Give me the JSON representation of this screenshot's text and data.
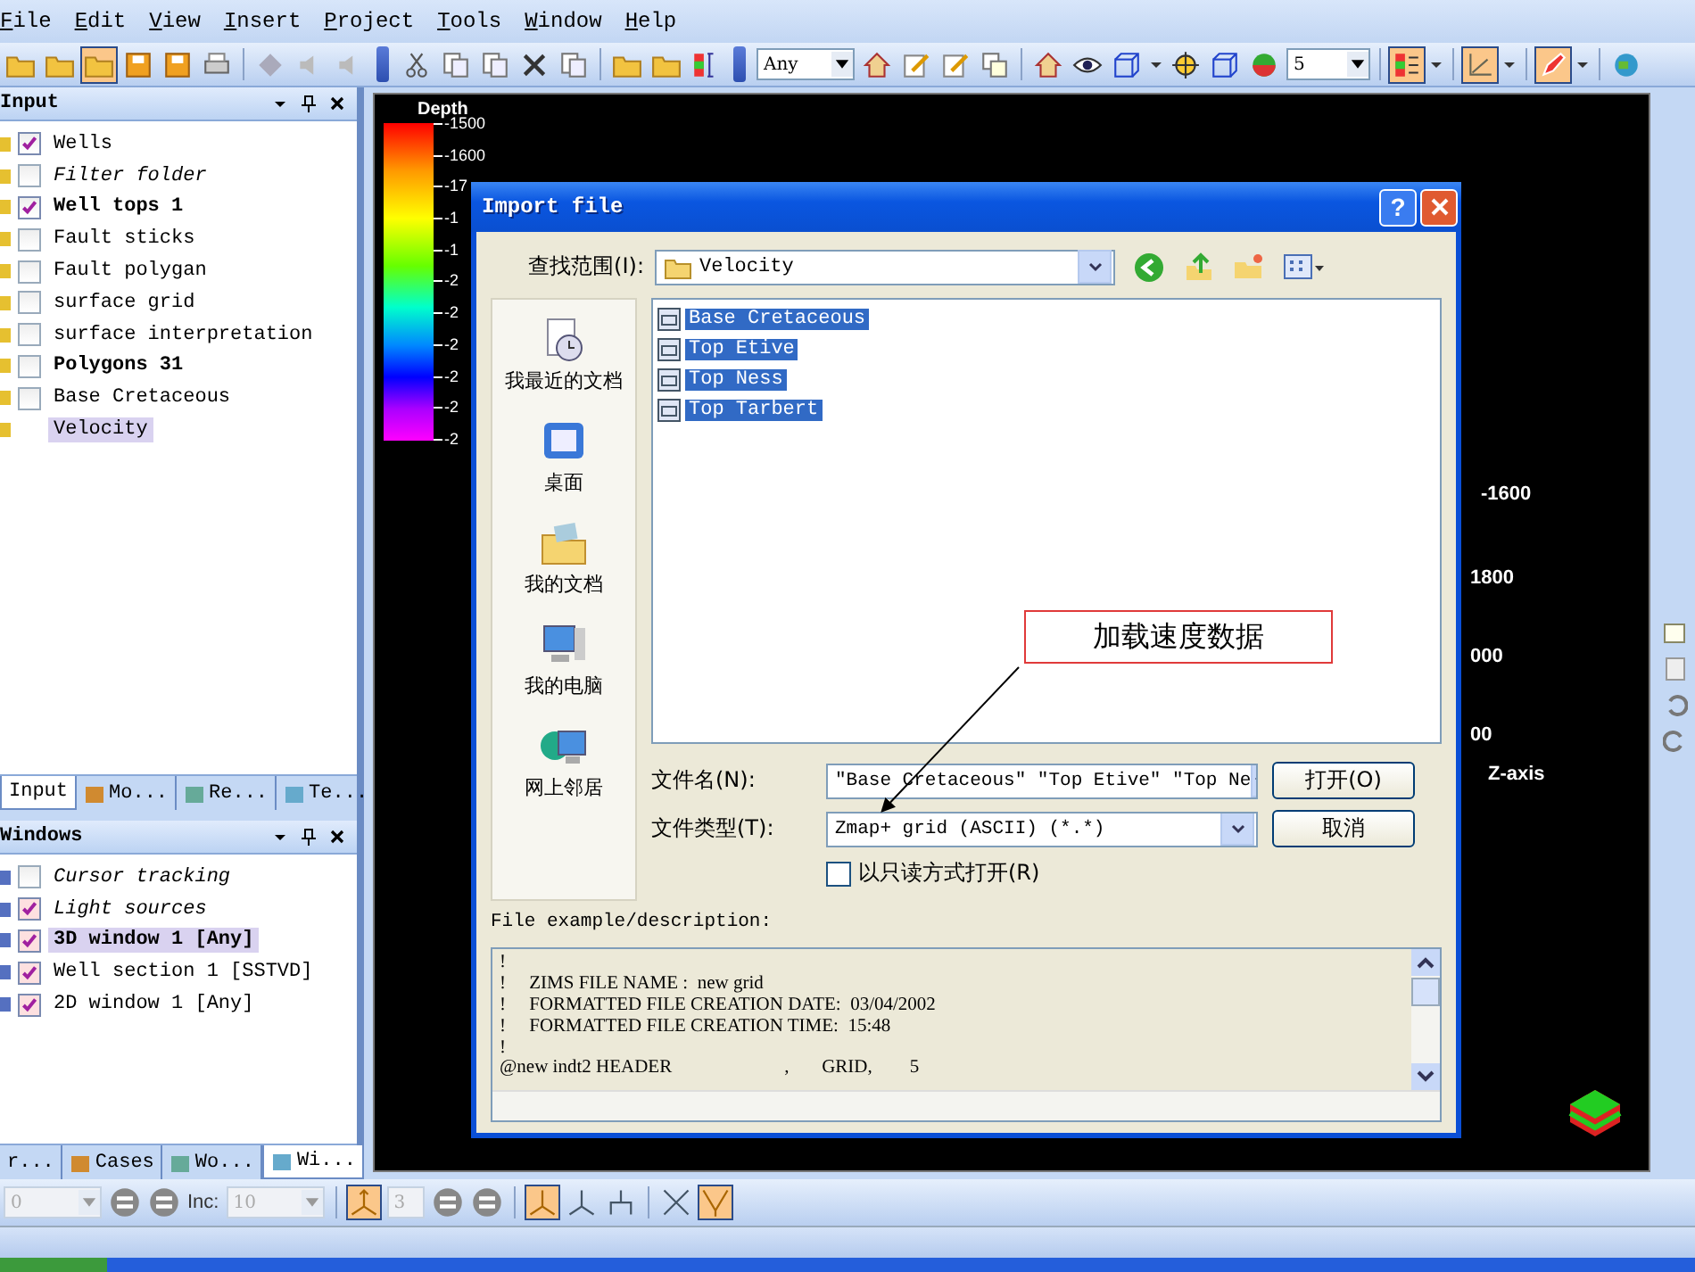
{
  "menu": [
    "File",
    "Edit",
    "View",
    "Insert",
    "Project",
    "Tools",
    "Window",
    "Help"
  ],
  "toolbar": {
    "filter_combo": "Any",
    "size_combo": "5"
  },
  "input_panel": {
    "title": "Input",
    "items": [
      {
        "label": "Wells",
        "kind": "check",
        "checked": true,
        "selected": false
      },
      {
        "label": "Filter folder",
        "kind": "check_italic",
        "checked": false,
        "selected": false
      },
      {
        "label": "Well tops 1",
        "kind": "check_bold",
        "checked": true,
        "selected": false
      },
      {
        "label": "Fault sticks",
        "kind": "check",
        "checked": false,
        "selected": false
      },
      {
        "label": "Fault polygan",
        "kind": "check",
        "checked": false,
        "selected": false
      },
      {
        "label": "surface grid",
        "kind": "check",
        "checked": false,
        "selected": false
      },
      {
        "label": "surface interpretation",
        "kind": "check",
        "checked": false,
        "selected": false
      },
      {
        "label": "Polygons 31",
        "kind": "check_bold",
        "checked": false,
        "selected": false
      },
      {
        "label": "Base Cretaceous",
        "kind": "check",
        "checked": false,
        "selected": false
      },
      {
        "label": "Velocity",
        "kind": "plain",
        "selected": true
      }
    ],
    "tabs": [
      {
        "label": "Input",
        "selected": true
      },
      {
        "label": "Mo...",
        "selected": false
      },
      {
        "label": "Re...",
        "selected": false
      },
      {
        "label": "Te...",
        "selected": false
      }
    ]
  },
  "windows_panel": {
    "title": "Windows",
    "items": [
      {
        "label": "Cursor tracking",
        "kind": "check_italic",
        "checked": false,
        "selected": false
      },
      {
        "label": "Light sources",
        "kind": "check_italic",
        "checked": true,
        "selected": false
      },
      {
        "label": "3D window 1 [Any]",
        "kind": "check_bold",
        "checked": true,
        "selected": true
      },
      {
        "label": "Well section 1 [SSTVD]",
        "kind": "check",
        "checked": true,
        "selected": false
      },
      {
        "label": "2D window 1 [Any]",
        "kind": "check",
        "checked": true,
        "selected": false
      }
    ],
    "tabs": [
      {
        "label": "r...",
        "selected": false
      },
      {
        "label": "Cases",
        "selected": false
      },
      {
        "label": "Wo...",
        "selected": false
      },
      {
        "label": "Wi...",
        "selected": true
      }
    ]
  },
  "viewport": {
    "legend_title": "Depth",
    "legend_ticks": [
      "-1500",
      "-1600",
      "-17",
      "-1",
      "-1",
      "-2",
      "-2",
      "-2",
      "-2",
      "-2",
      "-2"
    ],
    "axis_labels": [
      "-1600",
      "1800",
      "000",
      "00"
    ],
    "axis_title": "Z-axis"
  },
  "bottom_toolbar": {
    "start_combo": {
      "value": "0",
      "disabled": true
    },
    "inc_label": "Inc:",
    "inc_combo": {
      "value": "10",
      "disabled": true
    },
    "step_combo": {
      "value": "3",
      "disabled": true
    }
  },
  "dialog": {
    "title": "Import file",
    "help": "?",
    "look_in_label": "查找范围(I):",
    "look_in": "Velocity",
    "places": [
      "我最近的文档",
      "桌面",
      "我的文档",
      "我的电脑",
      "网上邻居"
    ],
    "files": [
      {
        "name": "Base Cretaceous",
        "selected": true
      },
      {
        "name": "Top Etive",
        "selected": true
      },
      {
        "name": "Top Ness",
        "selected": true
      },
      {
        "name": "Top Tarbert",
        "selected": true
      }
    ],
    "file_name_label": "文件名(N):",
    "file_name": "\"Base Cretaceous\" \"Top Etive\" \"Top Ne",
    "file_type_label": "文件类型(T):",
    "file_type": "Zmap+ grid (ASCII) (*.*)",
    "read_only": {
      "label": "以只读方式打开(R)",
      "checked": false
    },
    "open_button": "打开(O)",
    "cancel_button": "取消",
    "description_label": "File example/description:",
    "description_lines": [
      "!",
      "!     ZIMS FILE NAME :  new grid",
      "!     FORMATTED FILE CREATION DATE:  03/04/2002",
      "!     FORMATTED FILE CREATION TIME:  15:48",
      "!",
      "@new indt2 HEADER                        ,       GRID,        5"
    ]
  },
  "annotation": "加载速度数据"
}
